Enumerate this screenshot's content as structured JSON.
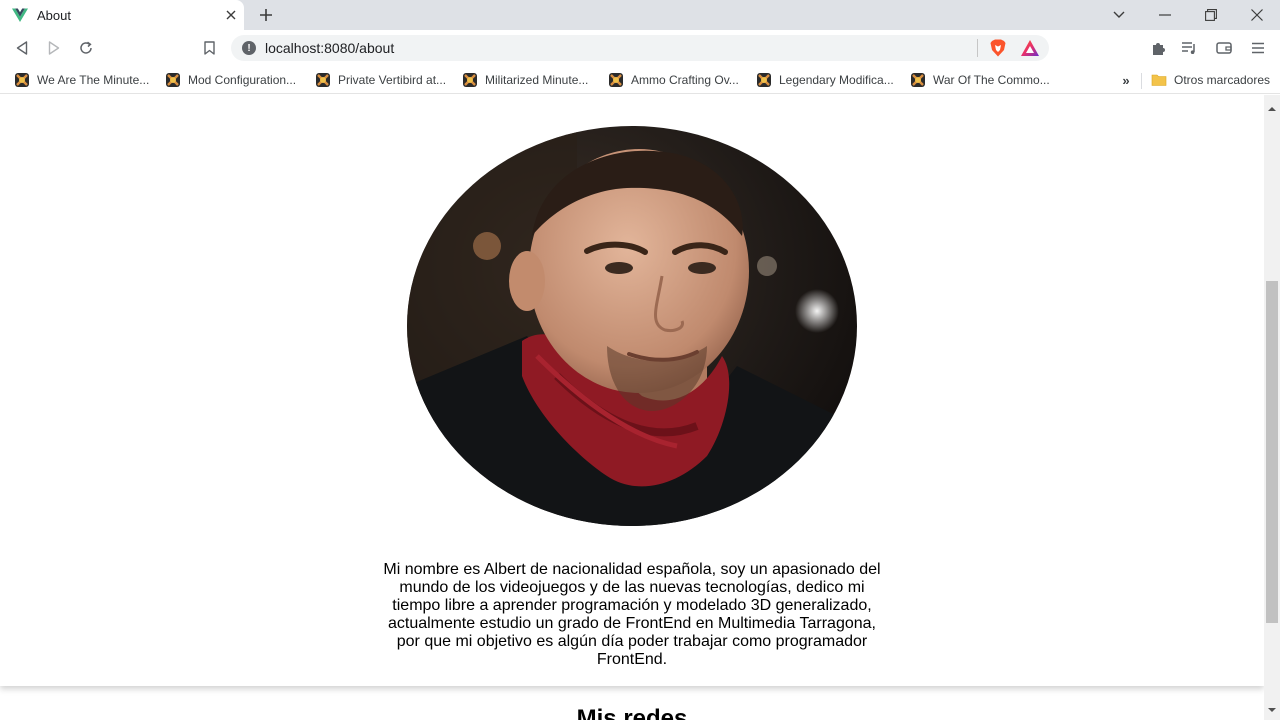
{
  "browser": {
    "tab": {
      "title": "About",
      "favicon": "vue-logo-icon"
    },
    "address": {
      "url": "localhost:8080/about"
    },
    "bookmarks": [
      {
        "label": "We Are The Minute..."
      },
      {
        "label": "Mod Configuration..."
      },
      {
        "label": "Private Vertibird at..."
      },
      {
        "label": "Militarized Minute..."
      },
      {
        "label": "Ammo Crafting Ov..."
      },
      {
        "label": "Legendary Modifica..."
      },
      {
        "label": "War Of The Commo..."
      }
    ],
    "bookmarks_overflow": "»",
    "other_bookmarks": "Otros marcadores"
  },
  "page": {
    "bio": "Mi nombre es Albert de nacionalidad española, soy un apasionado del mundo de los videojuegos y de las nuevas tecnologías, dedico mi tiempo libre a aprender programación y modelado 3D generalizado, actualmente estudio un grado de FrontEnd en Multimedia Tarragona, por que mi objetivo es algún día poder trabajar como programador FrontEnd.",
    "section_title": "Mis redes"
  },
  "colors": {
    "tabstrip": "#dee1e6",
    "vue_green": "#41b883",
    "vue_dark": "#35495e",
    "brave_orange": "#fb542b",
    "scarf_red": "#8f1a24"
  }
}
